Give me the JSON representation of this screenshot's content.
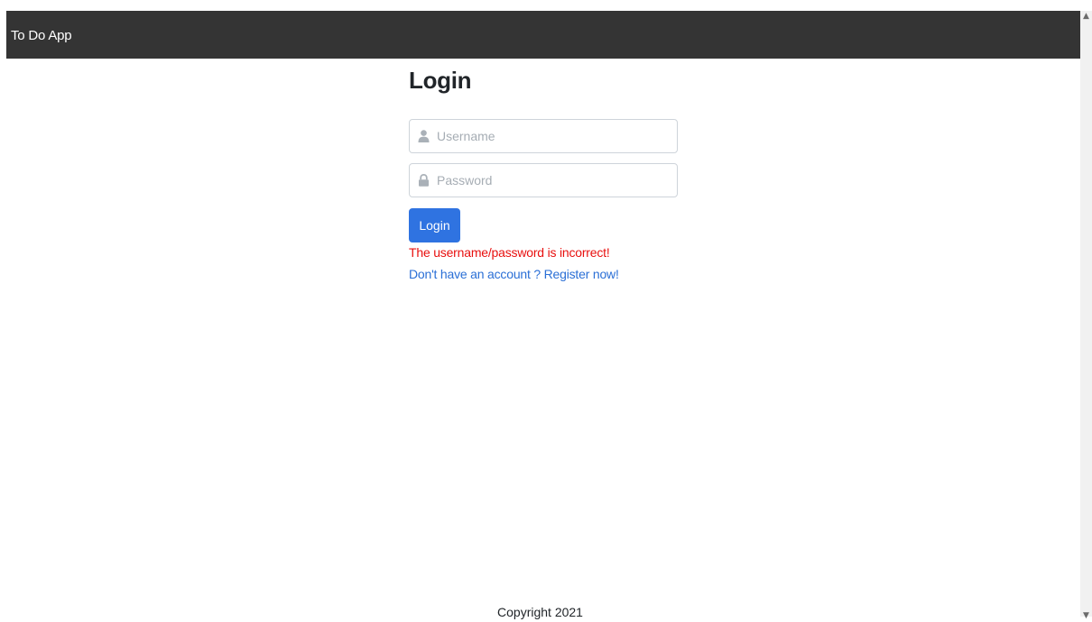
{
  "navbar": {
    "brand": "To Do App"
  },
  "login": {
    "title": "Login",
    "username": {
      "placeholder": "Username",
      "value": "",
      "icon": "user-icon"
    },
    "password": {
      "placeholder": "Password",
      "value": "",
      "icon": "lock-icon"
    },
    "submit_label": "Login",
    "error_message": "The username/password is incorrect!",
    "register_link": "Don't have an account ? Register now!"
  },
  "footer": {
    "copyright": "Copyright 2021"
  },
  "colors": {
    "navbar_bg": "#343434",
    "primary": "#2f73e1",
    "error": "#e8100f",
    "link": "#2a6fd6"
  }
}
